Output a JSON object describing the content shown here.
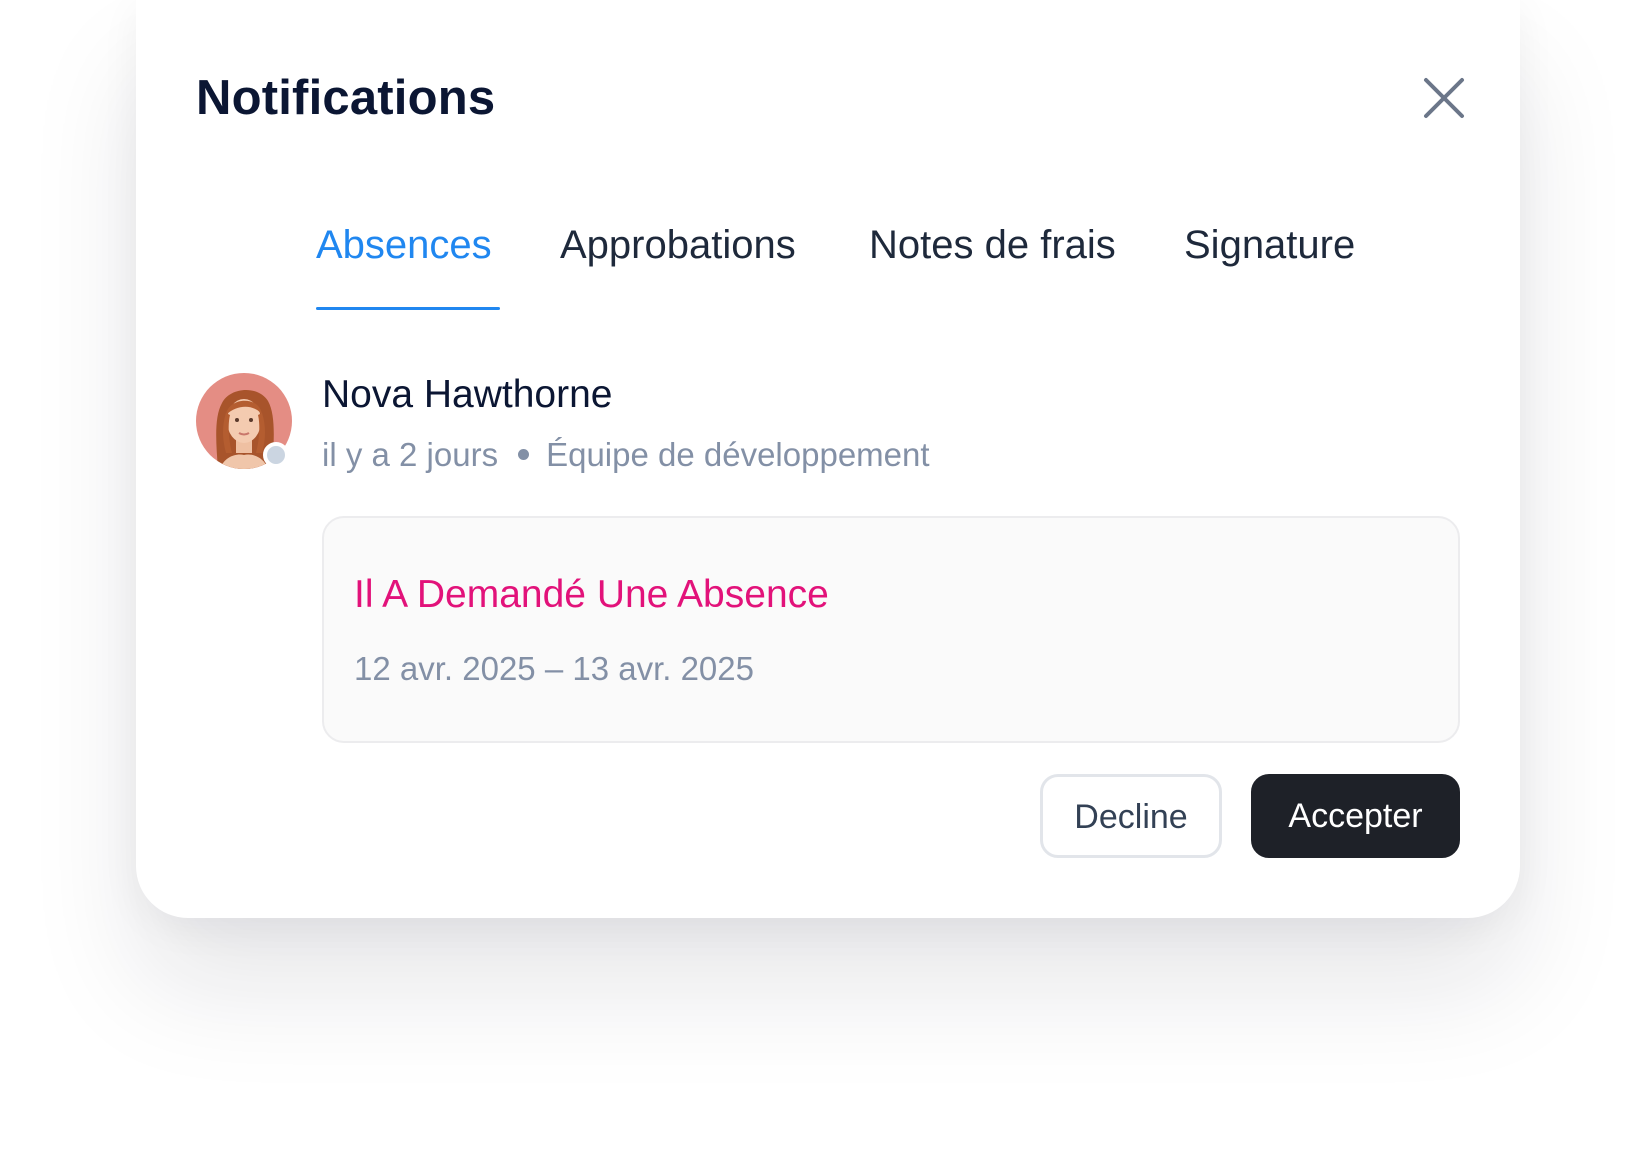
{
  "header": {
    "title": "Notifications",
    "close_icon": "close-icon"
  },
  "tabs": [
    {
      "label": "Absences",
      "active": true
    },
    {
      "label": "Approbations",
      "active": false
    },
    {
      "label": "Notes de frais",
      "active": false
    },
    {
      "label": "Signature",
      "active": false
    }
  ],
  "notification": {
    "user_name": "Nova Hawthorne",
    "time_ago": "il y a 2 jours",
    "team": "Équipe de développement",
    "status": "offline",
    "request_title": "Il A Demandé Une Absence",
    "request_dates": "12 avr. 2025 – 13 avr. 2025"
  },
  "actions": {
    "decline_label": "Decline",
    "accept_label": "Accepter"
  },
  "colors": {
    "accent": "#2087f0",
    "request_title": "#e2127a",
    "primary_button": "#1e2128",
    "muted_text": "#8390a6",
    "status_dot": "#cbd5e1"
  }
}
